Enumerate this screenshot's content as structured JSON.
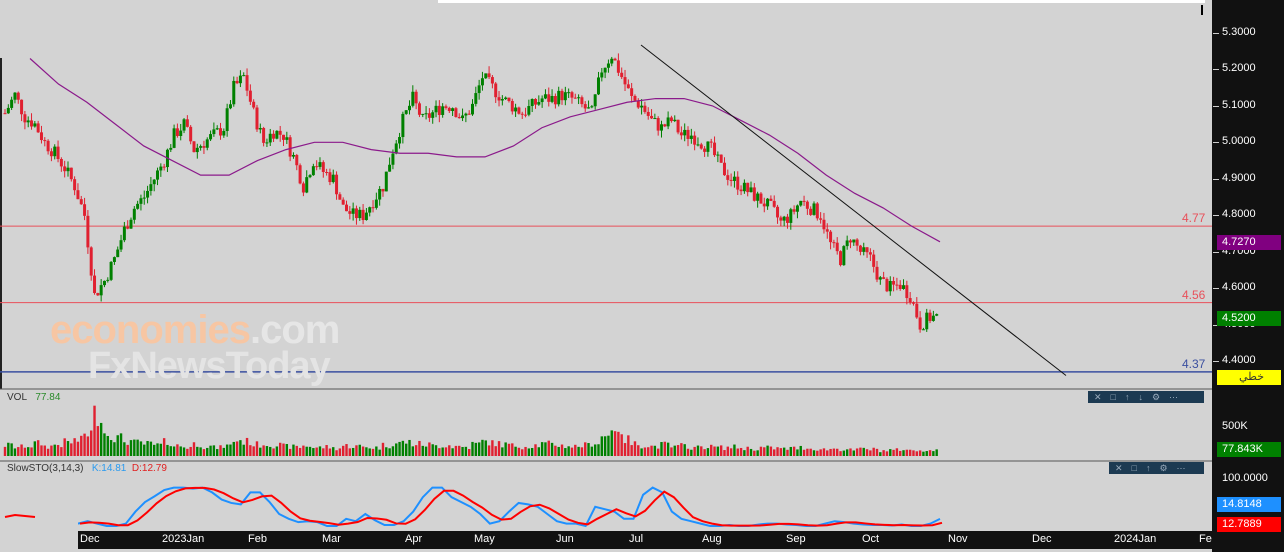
{
  "chart_data": {
    "type": "candlestick",
    "price_axis": {
      "ticks": [
        "5.3000",
        "5.2000",
        "5.1000",
        "5.0000",
        "4.9000",
        "4.8000",
        "4.7000",
        "4.6000",
        "4.5000",
        "4.4000"
      ],
      "range": [
        4.37,
        5.3
      ]
    },
    "x_axis": {
      "ticks": [
        "Dec",
        "2023Jan",
        "Feb",
        "Mar",
        "Apr",
        "May",
        "Jun",
        "Jul",
        "Aug",
        "Sep",
        "Oct",
        "Nov",
        "Dec",
        "2024Jan",
        "Feb"
      ]
    },
    "close": [
      5.08,
      5.13,
      5.07,
      5.05,
      5.0,
      4.97,
      4.93,
      4.88,
      4.8,
      4.58,
      4.62,
      4.68,
      4.76,
      4.82,
      4.85,
      4.9,
      4.95,
      5.02,
      5.05,
      4.98,
      5.0,
      5.02,
      5.04,
      5.15,
      5.18,
      5.08,
      5.0,
      5.03,
      5.02,
      4.96,
      4.88,
      4.95,
      4.92,
      4.9,
      4.82,
      4.8,
      4.8,
      4.84,
      4.88,
      4.98,
      5.06,
      5.12,
      5.06,
      5.08,
      5.1,
      5.1,
      5.06,
      5.1,
      5.18,
      5.15,
      5.12,
      5.1,
      5.08,
      5.1,
      5.12,
      5.12,
      5.13,
      5.12,
      5.1,
      5.08,
      5.2,
      5.24,
      5.18,
      5.12,
      5.1,
      5.06,
      5.04,
      5.06,
      5.02,
      5.02,
      5.0,
      4.98,
      4.93,
      4.9,
      4.88,
      4.86,
      4.84,
      4.82,
      4.78,
      4.8,
      4.84,
      4.82,
      4.8,
      4.72,
      4.68,
      4.74,
      4.7,
      4.68,
      4.62,
      4.6,
      4.61,
      4.58,
      4.5,
      4.52,
      4.52
    ],
    "moving_average": [
      5.23,
      5.16,
      5.11,
      5.05,
      4.99,
      4.95,
      4.91,
      4.91,
      4.95,
      4.98,
      5.0,
      5.0,
      4.98,
      4.97,
      4.97,
      4.96,
      4.96,
      4.99,
      5.04,
      5.07,
      5.09,
      5.11,
      5.12,
      5.12,
      5.1,
      5.06,
      5.02,
      4.97,
      4.91,
      4.86,
      4.82,
      4.77,
      4.727
    ],
    "trendline": [
      5.267,
      4.36
    ],
    "horizontal_lines": [
      {
        "value": "4.77",
        "color": "#e8505a"
      },
      {
        "value": "4.56",
        "color": "#e8505a"
      },
      {
        "value": "4.37",
        "color": "#3a4fa0"
      }
    ],
    "last_price": "4.5200",
    "ma_value": "4.7270",
    "line_tag": "خطي",
    "volume": {
      "title": "VOL",
      "value": "77.84",
      "tick": "500K",
      "last": "77.843K",
      "values": [
        180,
        150,
        170,
        210,
        160,
        190,
        230,
        260,
        380,
        700,
        380,
        300,
        250,
        220,
        200,
        180,
        230,
        170,
        150,
        200,
        160,
        140,
        170,
        260,
        240,
        190,
        200,
        180,
        160,
        150,
        170,
        140,
        150,
        130,
        170,
        160,
        150,
        140,
        180,
        210,
        230,
        200,
        190,
        170,
        180,
        160,
        150,
        200,
        240,
        210,
        190,
        170,
        160,
        180,
        200,
        190,
        170,
        160,
        180,
        220,
        330,
        500,
        280,
        200,
        180,
        160,
        190,
        150,
        170,
        140,
        160,
        150,
        140,
        150,
        130,
        120,
        140,
        130,
        120,
        130,
        140,
        120,
        110,
        120,
        110,
        100,
        120,
        110,
        90,
        100,
        110,
        90,
        100,
        90,
        80
      ]
    },
    "stochastic": {
      "title": "SlowSTO(3,14,3)",
      "k_label": "K:14.81",
      "d_label": "D:12.79",
      "tick_top": "100.0000",
      "k_last": "14.8148",
      "d_last": "12.7889",
      "k": [
        5,
        10,
        5,
        0,
        0,
        5,
        30,
        50,
        62,
        75,
        80,
        80,
        78,
        80,
        70,
        55,
        48,
        45,
        70,
        70,
        50,
        25,
        15,
        8,
        10,
        8,
        0,
        0,
        15,
        10,
        25,
        12,
        2,
        2,
        10,
        30,
        60,
        80,
        80,
        60,
        50,
        40,
        25,
        5,
        10,
        30,
        48,
        45,
        40,
        25,
        10,
        5,
        5,
        0,
        40,
        35,
        30,
        15,
        15,
        65,
        80,
        70,
        30,
        15,
        10,
        5,
        0,
        0,
        2,
        0,
        0,
        3,
        5,
        5,
        3,
        2,
        0,
        0,
        5,
        10,
        8,
        5,
        3,
        2,
        2,
        1,
        3,
        0,
        0,
        5,
        14.81
      ]
    }
  },
  "watermark": {
    "line1a": "economies",
    "line1b": ".com",
    "line2": "FxNewsToday"
  }
}
